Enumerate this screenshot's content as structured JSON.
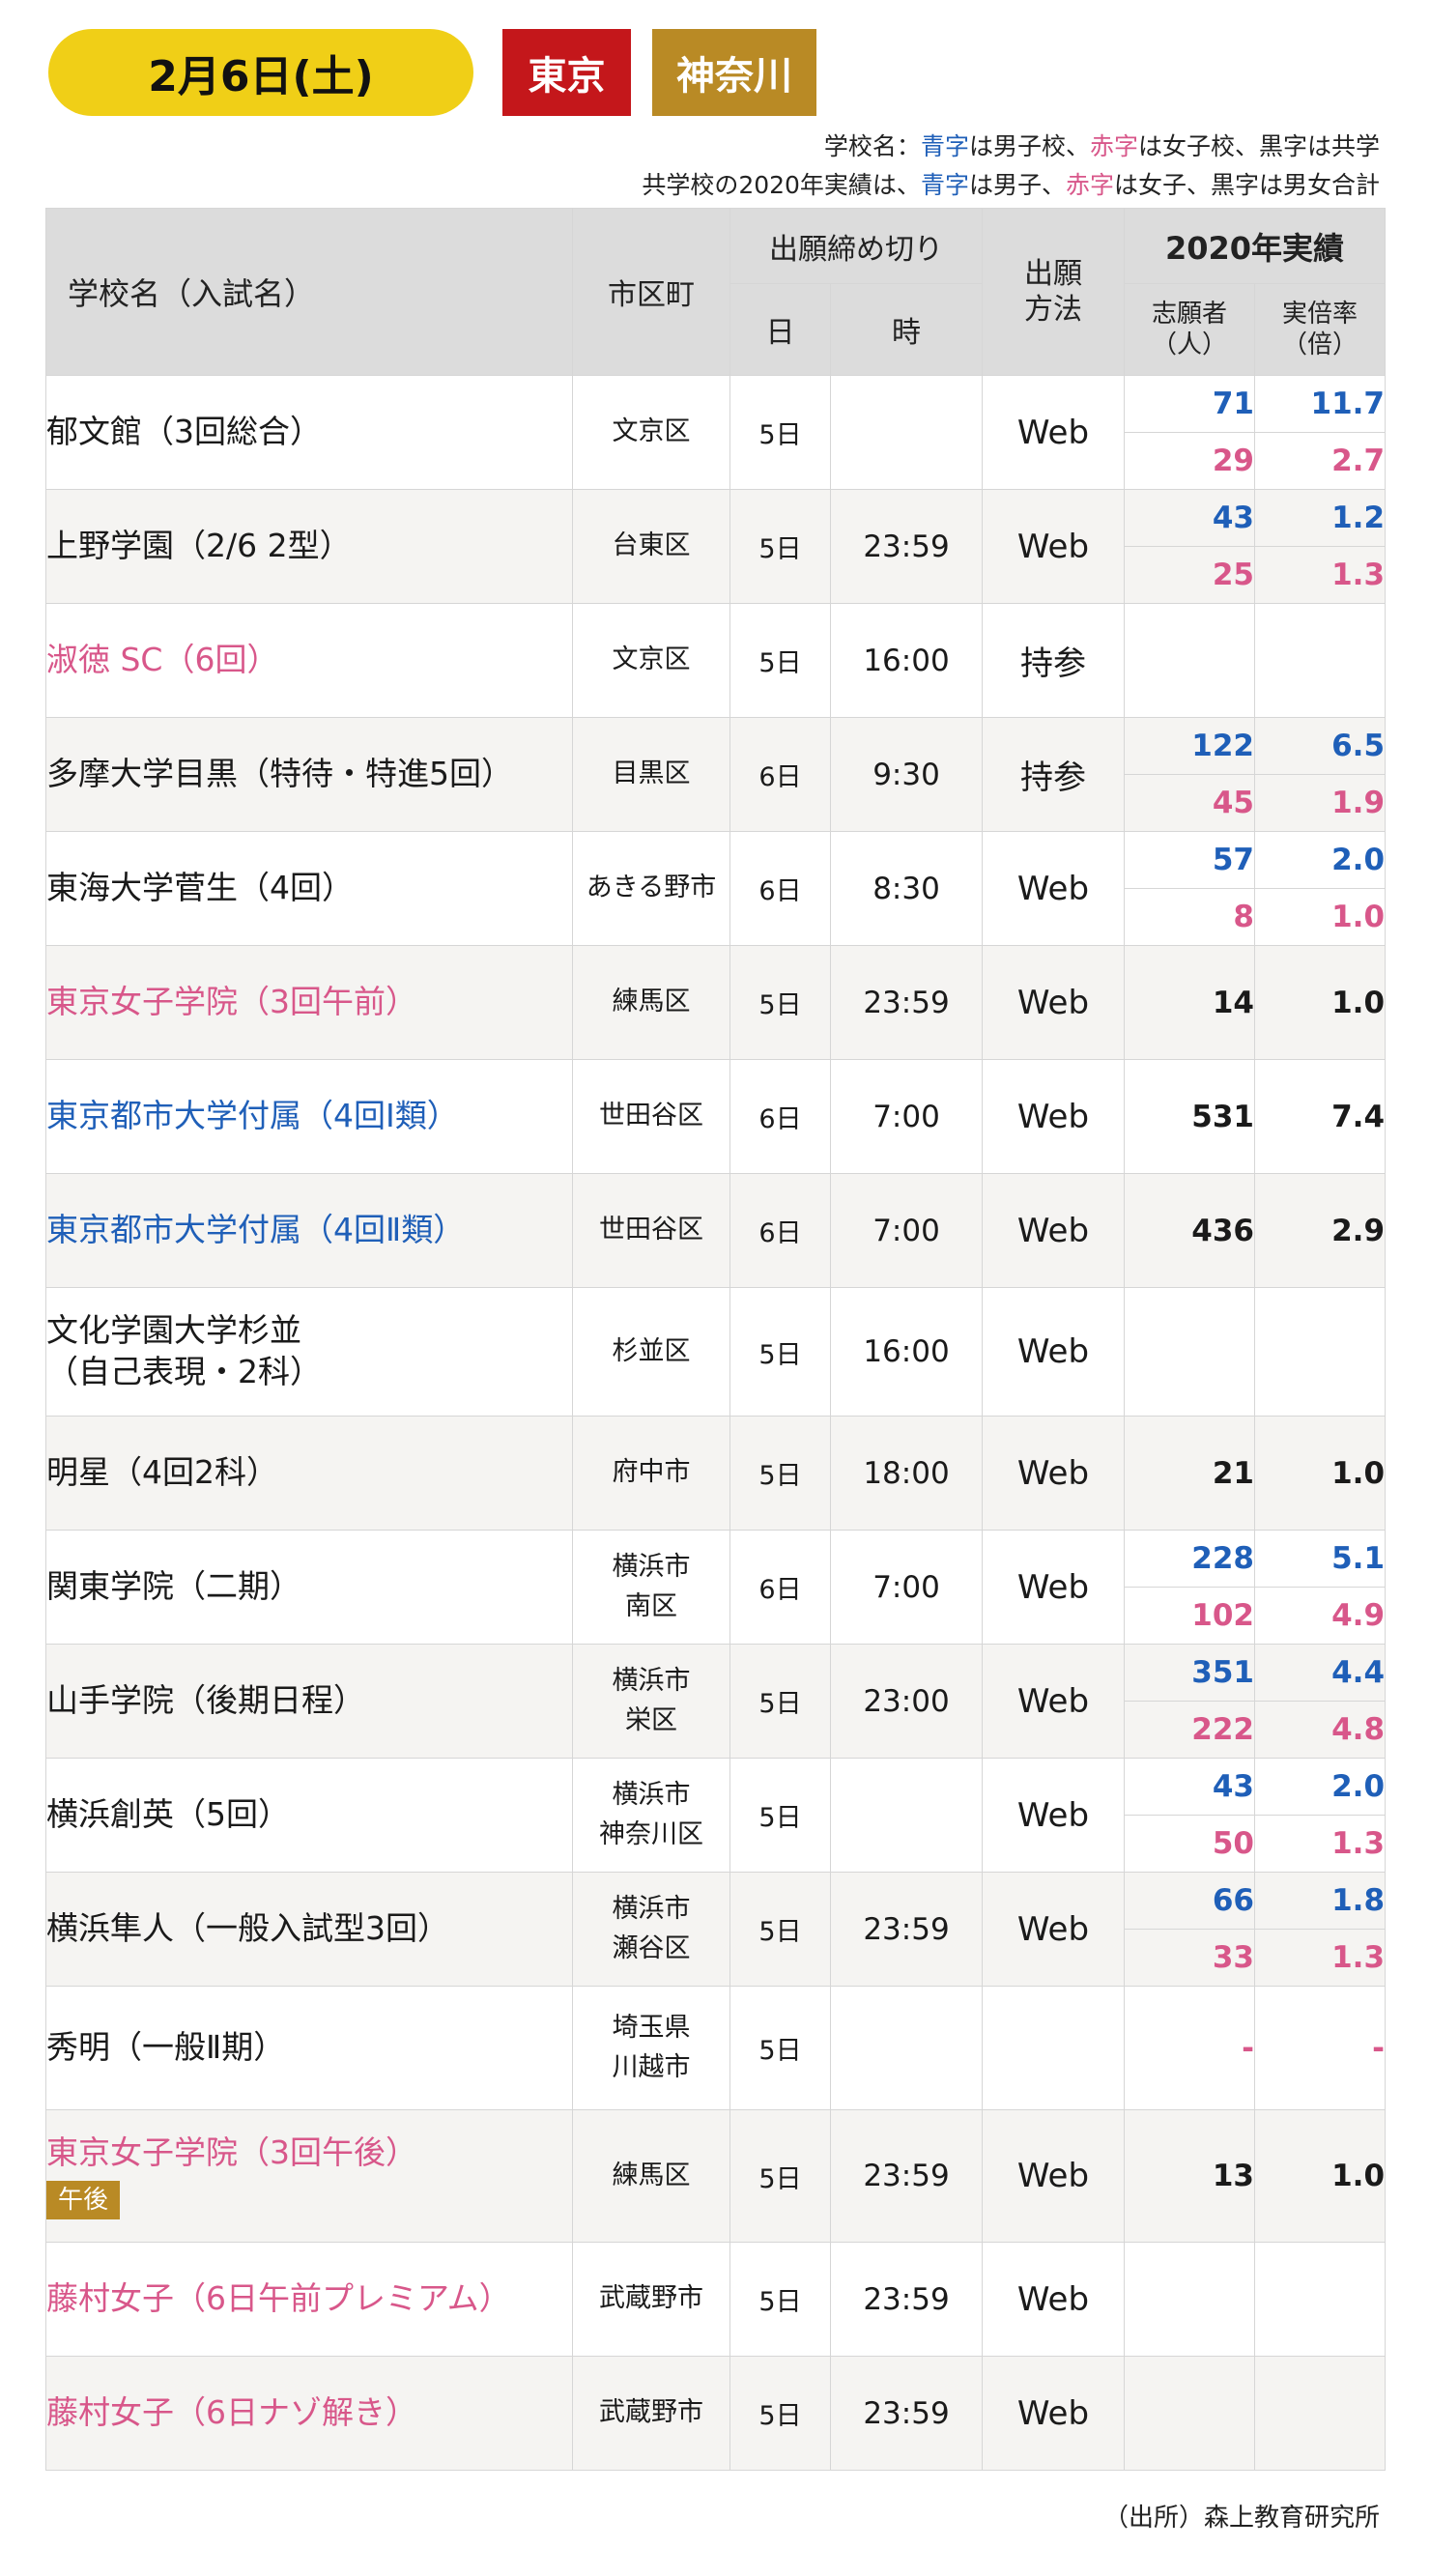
{
  "header": {
    "date": "2月6日(土)",
    "region_tokyo": "東京",
    "region_kanagawa": "神奈川",
    "legend1": {
      "prefix": "学校名：",
      "blue": "青字",
      "mid1": "は男子校、",
      "pink": "赤字",
      "mid2": "は女子校、黒字は共学"
    },
    "legend2": {
      "prefix": "共学校の2020年実績は、",
      "blue": "青字",
      "mid1": "は男子、",
      "pink": "赤字",
      "mid2": "は女子、黒字は男女合計"
    },
    "colors": {
      "yellow": "#f0cf17",
      "red": "#c4171b",
      "gold": "#b98a25",
      "blue": "#1f5fb8",
      "pink": "#d8578a"
    }
  },
  "table": {
    "headers": {
      "school": "学校名（入試名）",
      "city": "市区町",
      "deadline": "出願締め切り",
      "day": "日",
      "time": "時",
      "method": "出願方法",
      "perf": "2020年実績",
      "applicants": "志願者（人）",
      "ratio": "実倍率（倍）"
    },
    "rows": [
      {
        "school": "郁文館（3回総合）",
        "city": "文京区",
        "day": "5日",
        "time": "",
        "method": "Web",
        "a1": "71",
        "r1": "11.7",
        "a2": "29",
        "r2": "2.7"
      },
      {
        "school": "上野学園（2/6 2型）",
        "city": "台東区",
        "day": "5日",
        "time": "23:59",
        "method": "Web",
        "a1": "43",
        "r1": "1.2",
        "a2": "25",
        "r2": "1.3"
      },
      {
        "school": "淑徳 SC（6回）",
        "city": "文京区",
        "day": "5日",
        "time": "16:00",
        "method": "持参",
        "a": "",
        "r": ""
      },
      {
        "school": "多摩大学目黒（特待・特進5回）",
        "city": "目黒区",
        "day": "6日",
        "time": "9:30",
        "method": "持参",
        "a1": "122",
        "r1": "6.5",
        "a2": "45",
        "r2": "1.9"
      },
      {
        "school": "東海大学菅生（4回）",
        "city": "あきる野市",
        "day": "6日",
        "time": "8:30",
        "method": "Web",
        "a1": "57",
        "r1": "2.0",
        "a2": "8",
        "r2": "1.0"
      },
      {
        "school": "東京女子学院（3回午前）",
        "city": "練馬区",
        "day": "5日",
        "time": "23:59",
        "method": "Web",
        "a": "14",
        "r": "1.0"
      },
      {
        "school": "東京都市大学付属（4回Ⅰ類）",
        "city": "世田谷区",
        "day": "6日",
        "time": "7:00",
        "method": "Web",
        "a": "531",
        "r": "7.4"
      },
      {
        "school": "東京都市大学付属（4回Ⅱ類）",
        "city": "世田谷区",
        "day": "6日",
        "time": "7:00",
        "method": "Web",
        "a": "436",
        "r": "2.9"
      },
      {
        "school_l1": "文化学園大学杉並",
        "school_l2": "（自己表現・2科）",
        "city": "杉並区",
        "day": "5日",
        "time": "16:00",
        "method": "Web",
        "a": "",
        "r": ""
      },
      {
        "school": "明星（4回2科）",
        "city": "府中市",
        "day": "5日",
        "time": "18:00",
        "method": "Web",
        "a": "21",
        "r": "1.0"
      },
      {
        "school": "関東学院（二期）",
        "city_l1": "横浜市",
        "city_l2": "南区",
        "day": "6日",
        "time": "7:00",
        "method": "Web",
        "a1": "228",
        "r1": "5.1",
        "a2": "102",
        "r2": "4.9"
      },
      {
        "school": "山手学院（後期日程）",
        "city_l1": "横浜市",
        "city_l2": "栄区",
        "day": "5日",
        "time": "23:00",
        "method": "Web",
        "a1": "351",
        "r1": "4.4",
        "a2": "222",
        "r2": "4.8"
      },
      {
        "school": "横浜創英（5回）",
        "city_l1": "横浜市",
        "city_l2": "神奈川区",
        "day": "5日",
        "time": "",
        "method": "Web",
        "a1": "43",
        "r1": "2.0",
        "a2": "50",
        "r2": "1.3"
      },
      {
        "school": "横浜隼人（一般入試型3回）",
        "city_l1": "横浜市",
        "city_l2": "瀬谷区",
        "day": "5日",
        "time": "23:59",
        "method": "Web",
        "a1": "66",
        "r1": "1.8",
        "a2": "33",
        "r2": "1.3"
      },
      {
        "school": "秀明（一般Ⅱ期）",
        "city_l1": "埼玉県",
        "city_l2": "川越市",
        "day": "5日",
        "time": "",
        "method": "",
        "a": "-",
        "r": "-"
      },
      {
        "school": "東京女子学院（3回午後）",
        "badge": "午後",
        "city": "練馬区",
        "day": "5日",
        "time": "23:59",
        "method": "Web",
        "a": "13",
        "r": "1.0"
      },
      {
        "school": "藤村女子（6日午前プレミアム）",
        "city": "武蔵野市",
        "day": "5日",
        "time": "23:59",
        "method": "Web",
        "a": "",
        "r": ""
      },
      {
        "school": "藤村女子（6日ナゾ解き）",
        "city": "武蔵野市",
        "day": "5日",
        "time": "23:59",
        "method": "Web",
        "a": "",
        "r": ""
      }
    ]
  },
  "source": "（出所）森上教育研究所"
}
